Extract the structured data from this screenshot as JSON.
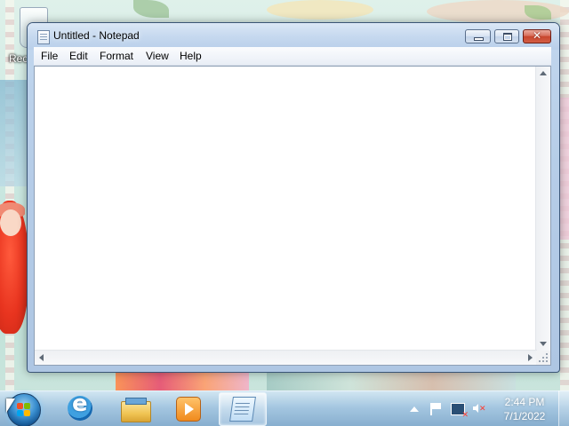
{
  "desktop": {
    "recycle_bin_label": "Rec"
  },
  "window": {
    "title": "Untitled - Notepad",
    "menu": [
      "File",
      "Edit",
      "Format",
      "View",
      "Help"
    ],
    "content": "",
    "caption_buttons": {
      "minimize_icon": "minimize-icon",
      "maximize_icon": "maximize-icon",
      "close_icon": "close-icon",
      "close_glyph": "✕"
    },
    "colors": {
      "close_button": "#c7452d",
      "title_bar": "#c6d9ef",
      "frame_border": "#3a5576"
    }
  },
  "taskbar": {
    "pinned": [
      {
        "name": "Internet Explorer",
        "icon": "internet-explorer-icon"
      },
      {
        "name": "Windows Explorer",
        "icon": "folder-icon"
      },
      {
        "name": "Windows Media Player",
        "icon": "media-player-icon"
      },
      {
        "name": "Notepad",
        "icon": "notepad-icon",
        "active": true
      }
    ],
    "tray_icons": [
      "show-hidden-icons-arrow",
      "action-center-flag-icon",
      "network-disconnected-icon",
      "volume-muted-icon"
    ],
    "clock": {
      "time": "2:44 PM",
      "date": "7/1/2022"
    }
  }
}
